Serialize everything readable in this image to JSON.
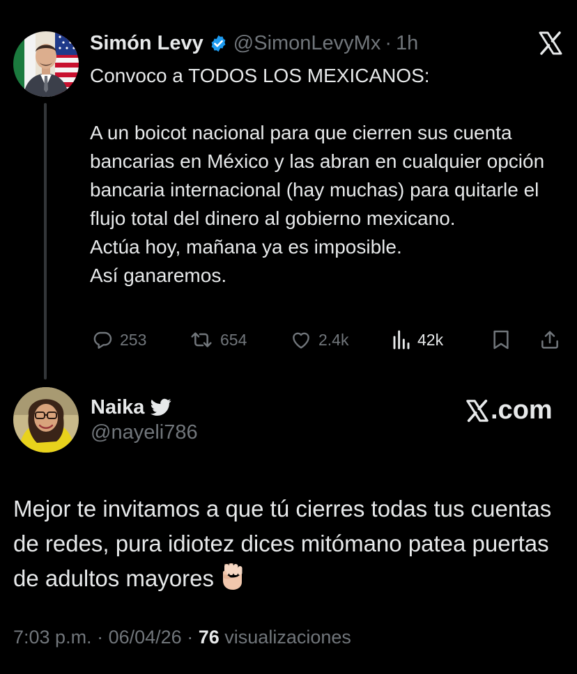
{
  "original_tweet": {
    "author_name": "Simón Levy",
    "handle": "@SimonLevyMx",
    "separator": "·",
    "time": "1h",
    "text_paragraphs": [
      "Convoco a TODOS LOS MEXICANOS:",
      "A un boicot nacional para que cierren sus cuenta bancarias en México y las abran en cualquier opción bancaria internacional (hay muchas) para quitarle el flujo total del dinero al gobierno mexicano.",
      "Actúa hoy, mañana ya es imposible.",
      "Así ganaremos."
    ],
    "actions": {
      "replies": "253",
      "retweets": "654",
      "likes": "2.4k",
      "views": "42k"
    }
  },
  "reply_tweet": {
    "author_name": "Naika",
    "handle": "@nayeli786",
    "brand": ".com",
    "text": "Mejor te invitamos a que tú cierres todas tus cuentas de redes, pura idiotez dices mitómano patea puertas de adultos mayores",
    "emoji": "raised-fist",
    "time": "7:03 p.m.",
    "separator": "·",
    "date": "06/04/26",
    "views_count": "76",
    "views_label": "visualizaciones"
  },
  "icons": {
    "verified": "verified-badge-icon",
    "x_logo": "x-logo-icon",
    "reply": "reply-icon",
    "retweet": "retweet-icon",
    "like": "heart-icon",
    "views": "views-icon",
    "bookmark": "bookmark-icon",
    "share": "share-icon",
    "bird": "twitter-bird-icon"
  },
  "colors": {
    "background": "#000000",
    "text": "#e7e9ea",
    "muted": "#71767b",
    "verified": "#1d9bf0",
    "thread_line": "#333639"
  }
}
